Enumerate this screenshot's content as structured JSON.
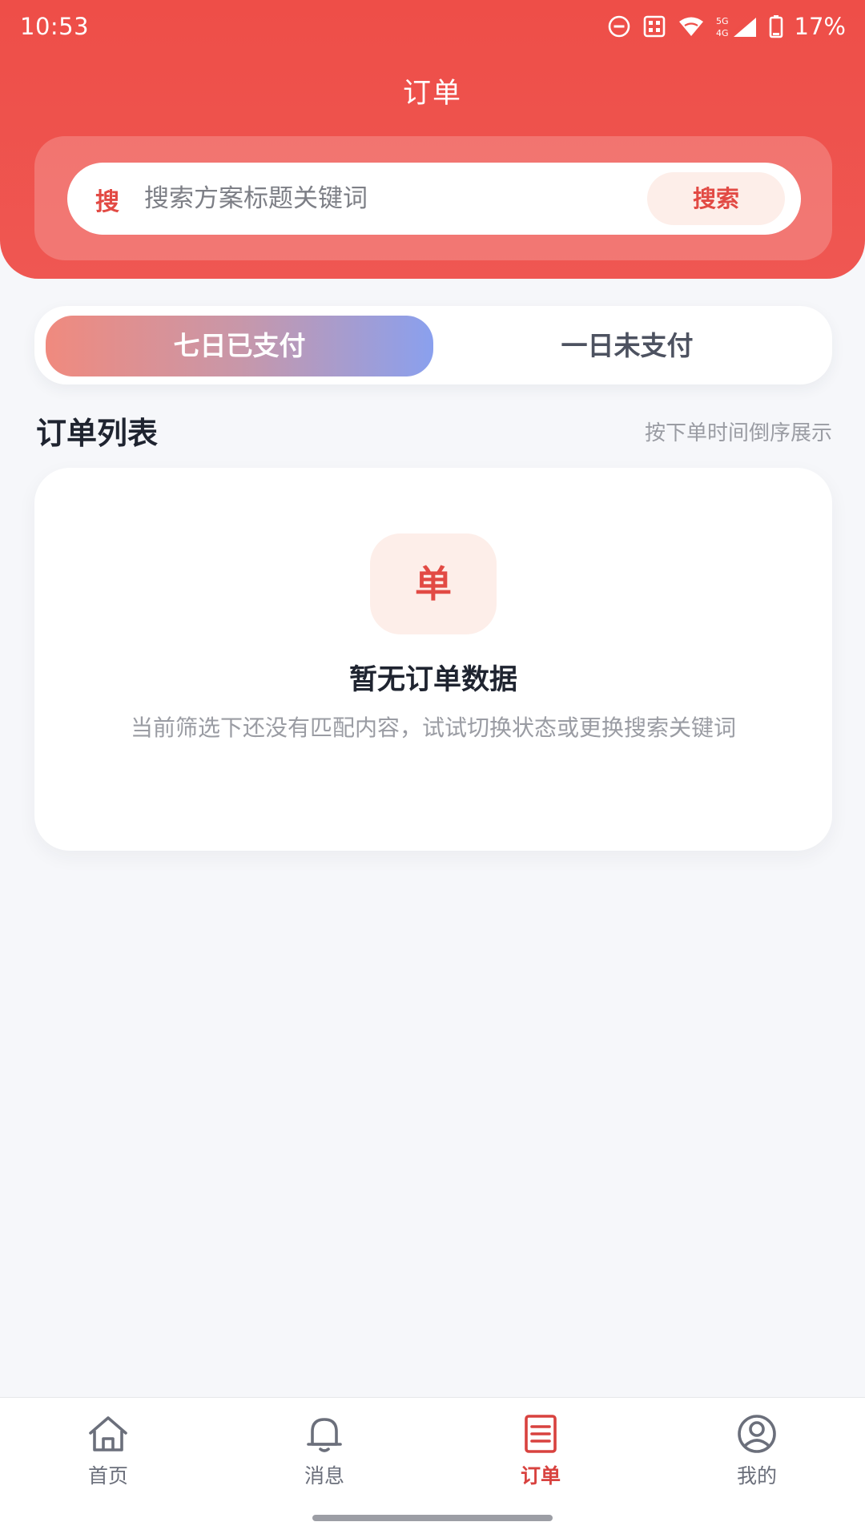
{
  "status_bar": {
    "time": "10:53",
    "network": "5G 4G",
    "battery": "17%",
    "icons": [
      "do-not-disturb-icon",
      "sim-icon",
      "wifi-icon",
      "signal-icon",
      "battery-icon"
    ]
  },
  "header": {
    "title": "订单",
    "background_color": "#ee4e48"
  },
  "search": {
    "prefix": "搜",
    "placeholder": "搜索方案标题关键词",
    "value": "",
    "button_label": "搜索"
  },
  "tabs": [
    {
      "label": "七日已支付",
      "active": true
    },
    {
      "label": "一日未支付",
      "active": false
    }
  ],
  "section": {
    "title": "订单列表",
    "hint": "按下单时间倒序展示"
  },
  "empty_state": {
    "icon_char": "单",
    "title": "暂无订单数据",
    "description": "当前筛选下还没有匹配内容，试试切换状态或更换搜索关键词"
  },
  "bottom_nav": [
    {
      "label": "首页",
      "icon": "home-icon",
      "active": false
    },
    {
      "label": "消息",
      "icon": "bell-icon",
      "active": false
    },
    {
      "label": "订单",
      "icon": "order-list-icon",
      "active": true
    },
    {
      "label": "我的",
      "icon": "user-icon",
      "active": false
    }
  ],
  "colors": {
    "accent": "#e24a44",
    "nav_active": "#d8423f",
    "nav_inactive": "#6b6f7b"
  }
}
